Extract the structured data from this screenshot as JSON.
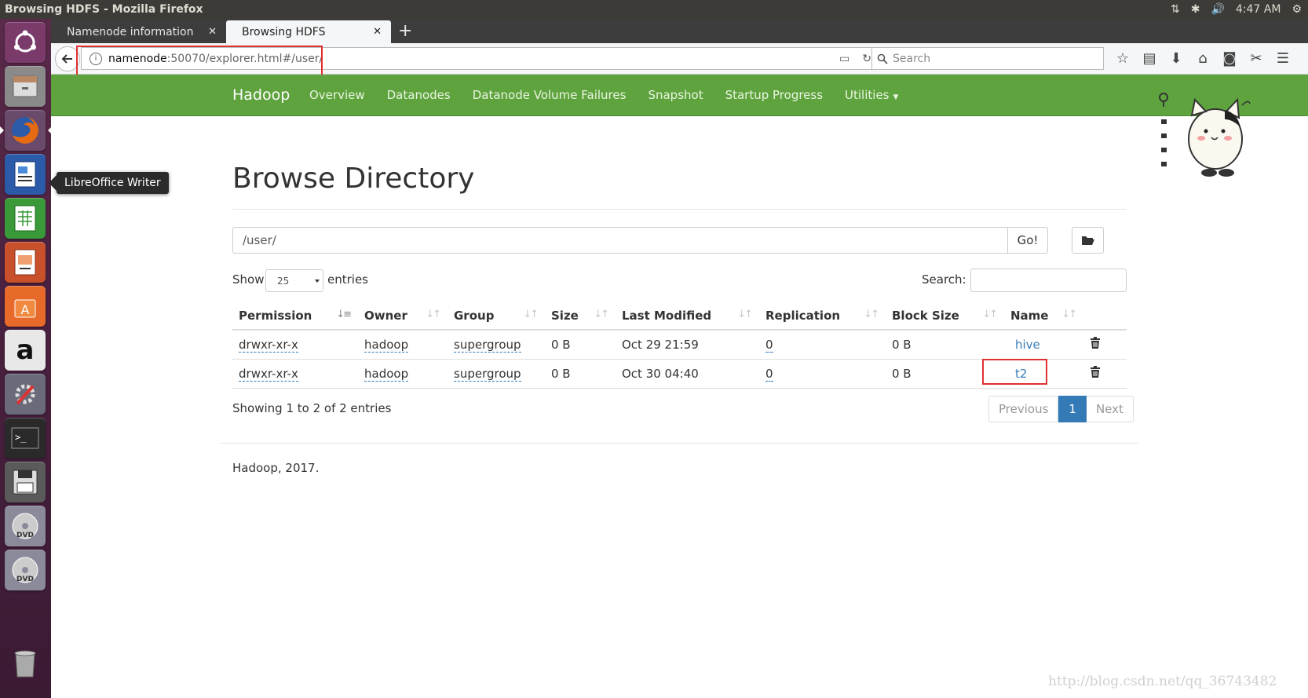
{
  "window": {
    "title": "Browsing HDFS - Mozilla Firefox",
    "time": "4:47 AM"
  },
  "launcher": {
    "tooltip": "LibreOffice Writer",
    "items": [
      "ubuntu-dash-icon",
      "files-icon",
      "firefox-icon",
      "libreoffice-writer-icon",
      "libreoffice-calc-icon",
      "libreoffice-impress-icon",
      "software-center-icon",
      "amazon-icon",
      "system-settings-icon",
      "terminal-icon",
      "floppy-disk-icon",
      "dvd-icon",
      "dvd-icon",
      "trash-icon"
    ]
  },
  "tabs": [
    {
      "label": "Namenode information",
      "active": false
    },
    {
      "label": "Browsing HDFS",
      "active": true
    }
  ],
  "urlbar": {
    "host": "namenode",
    "path": ":50070/explorer.html#/user/"
  },
  "searchbar": {
    "placeholder": "Search"
  },
  "hadoop_nav": {
    "brand": "Hadoop",
    "items": [
      "Overview",
      "Datanodes",
      "Datanode Volume Failures",
      "Snapshot",
      "Startup Progress",
      "Utilities"
    ]
  },
  "page": {
    "title": "Browse Directory",
    "path_value": "/user/",
    "go_label": "Go!",
    "show_label": "Show",
    "entries_value": "25",
    "entries_label": "entries",
    "search_label": "Search:",
    "showing_text": "Showing 1 to 2 of 2 entries",
    "footer": "Hadoop, 2017."
  },
  "table": {
    "columns": [
      "Permission",
      "Owner",
      "Group",
      "Size",
      "Last Modified",
      "Replication",
      "Block Size",
      "Name"
    ],
    "rows": [
      [
        "drwxr-xr-x",
        "hadoop",
        "supergroup",
        "0 B",
        "Oct 29 21:59",
        "0",
        "0 B",
        "hive"
      ],
      [
        "drwxr-xr-x",
        "hadoop",
        "supergroup",
        "0 B",
        "Oct 30 04:40",
        "0",
        "0 B",
        "t2"
      ]
    ]
  },
  "pagination": {
    "previous": "Previous",
    "current": "1",
    "next": "Next"
  },
  "watermark": "http://blog.csdn.net/qq_36743482",
  "colors": {
    "hadoop_green": "#5fa33e",
    "link_blue": "#337ab7",
    "annotation_red": "#e03030",
    "launcher_purple": "#4a2140"
  }
}
